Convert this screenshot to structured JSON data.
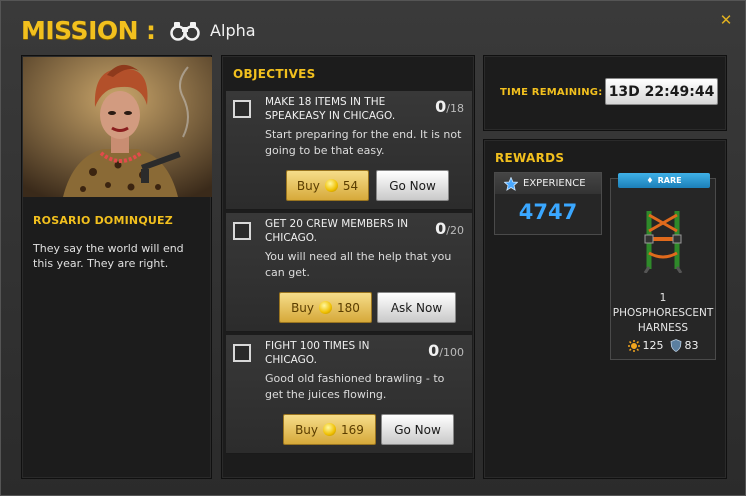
{
  "header": {
    "label": "MISSION",
    "colon": ":",
    "mission_name": "Alpha",
    "close_symbol": "✕",
    "icon": "binoculars-icon"
  },
  "character": {
    "name": "ROSARIO DOMINQUEZ",
    "description": "They say the world will end this year. They are right."
  },
  "objectives": {
    "title": "OBJECTIVES",
    "items": [
      {
        "title": "MAKE 18 ITEMS IN THE SPEAKEASY IN CHICAGO.",
        "progress": "0",
        "total": "/18",
        "description": "Start preparing for the end. It is not going to be that easy.",
        "buy_label": "Buy",
        "buy_cost": "54",
        "action_label": "Go Now"
      },
      {
        "title": "GET 20 CREW MEMBERS IN CHICAGO.",
        "progress": "0",
        "total": "/20",
        "description": "You will need all the help that you can get.",
        "buy_label": "Buy",
        "buy_cost": "180",
        "action_label": "Ask Now"
      },
      {
        "title": "FIGHT 100 TIMES IN CHICAGO.",
        "progress": "0",
        "total": "/100",
        "description": "Good old fashioned brawling - to get the juices flowing.",
        "buy_label": "Buy",
        "buy_cost": "169",
        "action_label": "Go Now"
      }
    ]
  },
  "time": {
    "label": "TIME REMAINING:",
    "value": "13D 22:49:44"
  },
  "rewards": {
    "title": "REWARDS",
    "experience": {
      "label": "EXPERIENCE",
      "value": "4747"
    },
    "item": {
      "rarity": "RARE",
      "quantity": "1",
      "name": "PHOSPHORESCENT HARNESS",
      "attack": "125",
      "defense": "83"
    }
  },
  "colors": {
    "accent": "#f2c01e",
    "experience": "#3aa7ff",
    "rare": "#2a95d0"
  }
}
